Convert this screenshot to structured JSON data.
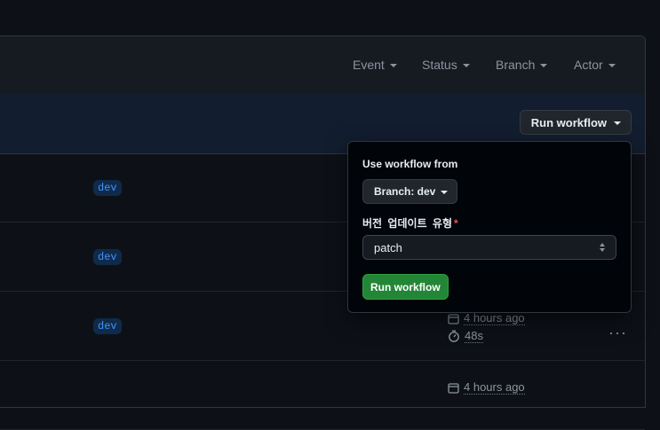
{
  "filters": [
    "Event",
    "Status",
    "Branch",
    "Actor"
  ],
  "banner": {
    "run_workflow_label": "Run workflow"
  },
  "runs": [
    {
      "branch": "dev"
    },
    {
      "branch": "dev"
    },
    {
      "branch": "dev",
      "time": "4 hours ago",
      "duration": "48s"
    },
    {
      "time": "4 hours ago"
    }
  ],
  "dropdown": {
    "title": "Use workflow from",
    "branch_label": "Branch: dev",
    "field_label": "버전 업데이트 유형",
    "required_mark": "*",
    "select_value": "patch",
    "submit_label": "Run workflow"
  },
  "colors": {
    "accent_green": "#238636",
    "link_blue": "#4493f8",
    "required_red": "#f85149"
  }
}
